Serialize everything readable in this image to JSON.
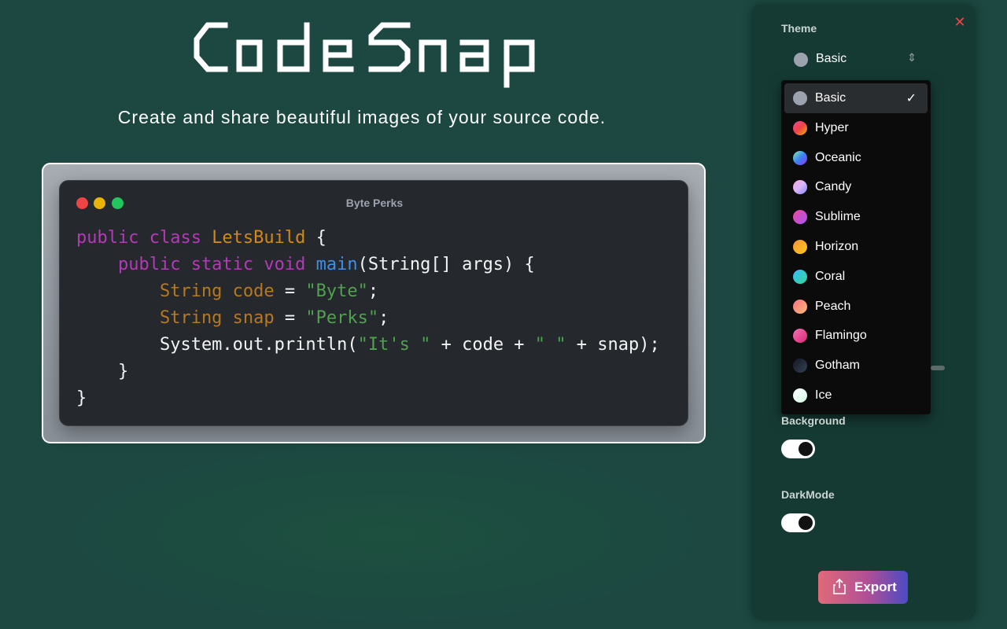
{
  "header": {
    "logo_text": "Code Snap",
    "tagline": "Create and share beautiful images of your source code."
  },
  "code_window": {
    "title": "Byte Perks",
    "lines": [
      [
        {
          "t": "public class ",
          "c": "kw"
        },
        {
          "t": "LetsBuild",
          "c": "cls"
        },
        {
          "t": " {",
          "c": ""
        }
      ],
      [
        {
          "t": "    public static void ",
          "c": "kw"
        },
        {
          "t": "main",
          "c": "fn"
        },
        {
          "t": "(String[] args) {",
          "c": ""
        }
      ],
      [
        {
          "t": "        String code",
          "c": "ty"
        },
        {
          "t": " = ",
          "c": ""
        },
        {
          "t": "\"Byte\"",
          "c": "str"
        },
        {
          "t": ";",
          "c": ""
        }
      ],
      [
        {
          "t": "        String snap",
          "c": "ty"
        },
        {
          "t": " = ",
          "c": ""
        },
        {
          "t": "\"Perks\"",
          "c": "str"
        },
        {
          "t": ";",
          "c": ""
        }
      ],
      [
        {
          "t": "        System.out.println(",
          "c": ""
        },
        {
          "t": "\"It's \"",
          "c": "str"
        },
        {
          "t": " + code + ",
          "c": ""
        },
        {
          "t": "\" \"",
          "c": "str"
        },
        {
          "t": " + snap);",
          "c": ""
        }
      ],
      [
        {
          "t": "    }",
          "c": ""
        }
      ],
      [
        {
          "t": "}",
          "c": ""
        }
      ]
    ]
  },
  "colors": {
    "background": "#1c4841",
    "panel": "#153a34",
    "keyword": "#b43ab8",
    "class_name": "#d48a12",
    "function": "#3f8ee8",
    "type": "#b7791f",
    "string": "#50a14f"
  },
  "settings_panel": {
    "close_icon": "close-icon",
    "theme_label": "Theme",
    "theme_selected": "Basic",
    "theme_options": [
      {
        "label": "Basic",
        "swatch": "#9ca3af",
        "selected": true
      },
      {
        "label": "Hyper",
        "swatch": "linear-gradient(135deg,#ec4899,#ef4444,#eab308)",
        "selected": false
      },
      {
        "label": "Oceanic",
        "swatch": "linear-gradient(135deg,#86efac,#3b82f6,#9333ea)",
        "selected": false
      },
      {
        "label": "Candy",
        "swatch": "linear-gradient(135deg,#f9a8d4,#d8b4fe,#818cf8)",
        "selected": false
      },
      {
        "label": "Sublime",
        "swatch": "linear-gradient(135deg,#ec4899,#a855f7)",
        "selected": false
      },
      {
        "label": "Horizon",
        "swatch": "linear-gradient(135deg,#fb923c,#facc15)",
        "selected": false
      },
      {
        "label": "Coral",
        "swatch": "linear-gradient(135deg,#38bdf8,#34d399)",
        "selected": false
      },
      {
        "label": "Peach",
        "swatch": "linear-gradient(135deg,#fb7185,#fdba74)",
        "selected": false
      },
      {
        "label": "Flamingo",
        "swatch": "linear-gradient(135deg,#f472b6,#db2777)",
        "selected": false
      },
      {
        "label": "Gotham",
        "swatch": "linear-gradient(135deg,#111827,#374151)",
        "selected": false
      },
      {
        "label": "Ice",
        "swatch": "linear-gradient(135deg,#ffffff,#d1fae5)",
        "selected": false
      }
    ],
    "background_label": "Background",
    "background_on": true,
    "darkmode_label": "DarkMode",
    "darkmode_on": true,
    "export_label": "Export"
  }
}
